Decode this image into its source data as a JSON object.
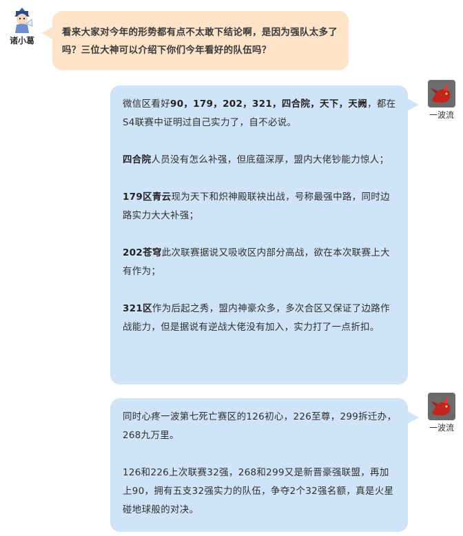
{
  "question": {
    "author": "诸小葛",
    "text": "看来大家对今年的形势都有点不太敢下结论啊，是因为强队太多了吗？三位大神可以介绍下你们今年看好的队伍吗？"
  },
  "answer1": {
    "author": "一波流",
    "p1_pre": "微信区看好",
    "p1_bold": "90，179，202，321，四合院，天下，天阙",
    "p1_post": "，都在S4联赛中证明过自己实力了，自不必说。",
    "p2_bold": "四合院",
    "p2_text": "人员没有怎么补强，但底蕴深厚，盟内大佬钞能力惊人；",
    "p3_bold": "179区青云",
    "p3_text": "现为天下和炽神殿联袂出战，号称最强中路，同时边路实力大大补强；",
    "p4_bold": "202苍穹",
    "p4_text": "此次联赛据说又吸收区内部分高战，欲在本次联赛上大有作为；",
    "p5_bold": "321区",
    "p5_text": "作为后起之秀，盟内神豪众多，多次合区又保证了边路作战能力，但是据说有逆战大佬没有加入，实力打了一点折扣。"
  },
  "answer2": {
    "author": "一波流",
    "p1": "同时心疼一波第七死亡赛区的126初心，226至尊，299拆迁办，268九万里。",
    "p2": "126和226上次联赛32强，268和299又是新晋豪强联盟，再加上90，拥有五支32强实力的队伍，争夺2个32强名额，真是火星碰地球般的对决。"
  }
}
